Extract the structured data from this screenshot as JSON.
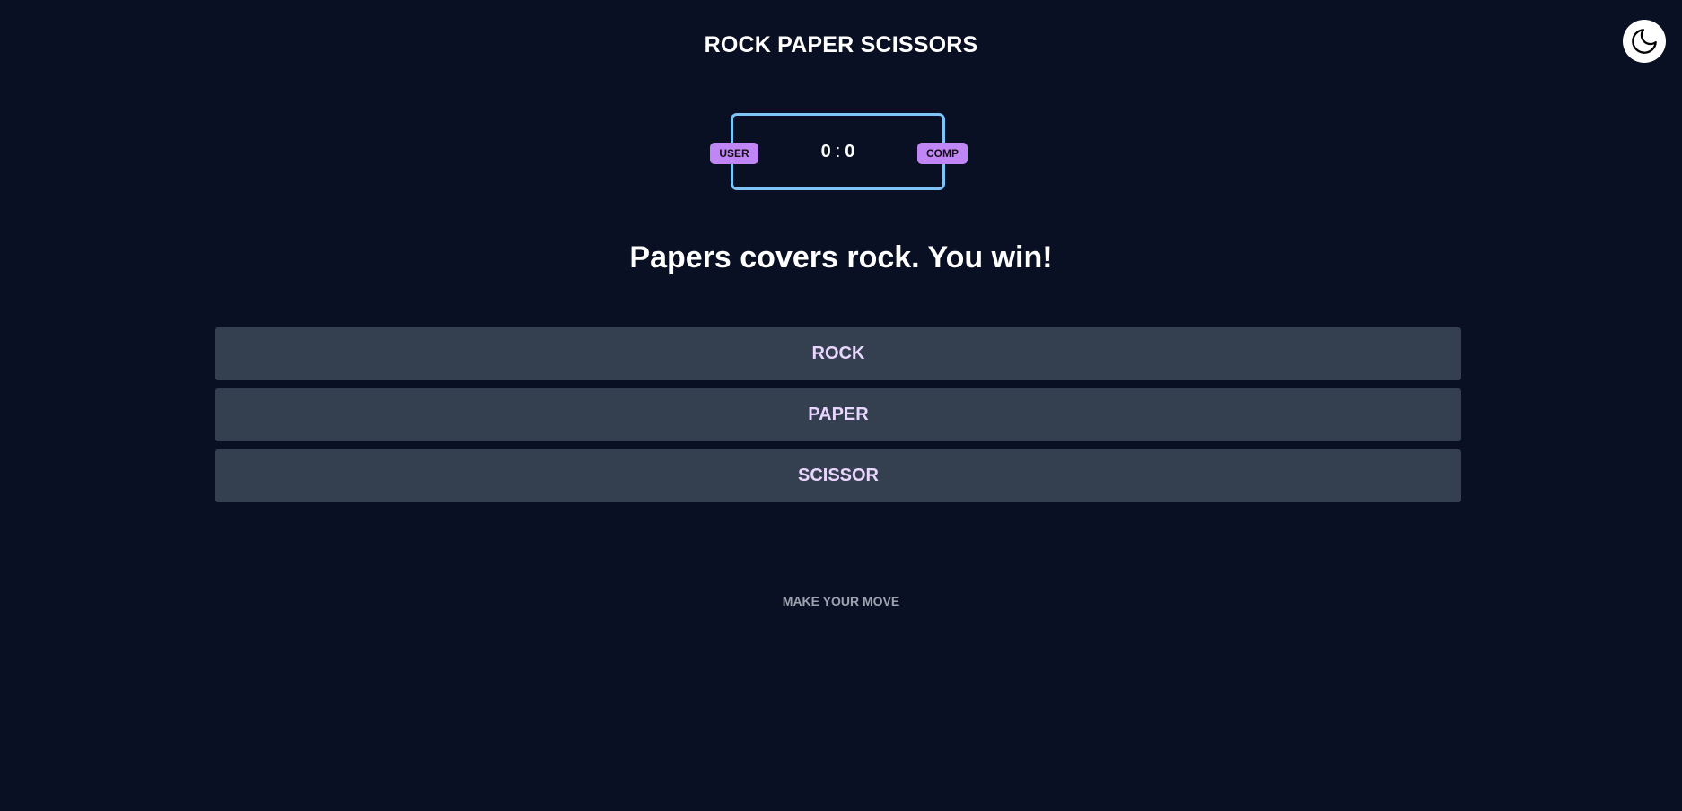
{
  "header": {
    "title": "ROCK PAPER SCISSORS",
    "theme_toggle_icon": "moon-icon"
  },
  "scoreboard": {
    "user_label": "USER",
    "comp_label": "COMP",
    "user_score": "0",
    "separator": ":",
    "comp_score": "0"
  },
  "result": {
    "message": "Papers covers rock. You win!"
  },
  "moves": [
    {
      "label": "ROCK"
    },
    {
      "label": "PAPER"
    },
    {
      "label": "SCISSOR"
    }
  ],
  "footer": {
    "hint": "MAKE YOUR MOVE"
  },
  "colors": {
    "background": "#0a1023",
    "scoreboard_border": "#7ec4f6",
    "badge": "#c186f6",
    "button_bg": "#343f50",
    "button_text": "#e9d6ff",
    "hint_text": "#9ca3af"
  }
}
